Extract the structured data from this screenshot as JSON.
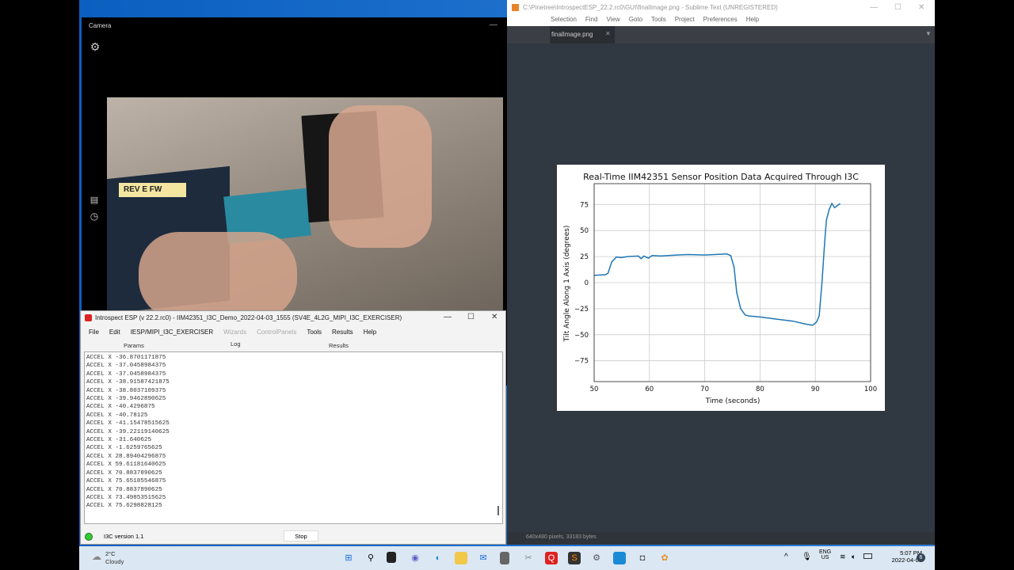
{
  "camera": {
    "title": "Camera"
  },
  "introspect": {
    "title": "Introspect ESP (v 22.2.rc0) - IIM42351_I3C_Demo_2022-04-03_1555 (SV4E_4L2G_MIPI_I3C_EXERCISER)",
    "menu": [
      "File",
      "Edit",
      "IESP/MIPI_I3C_EXERCISER",
      "Wizards",
      "ControlPanels",
      "Tools",
      "Results",
      "Help"
    ],
    "tabs": [
      "Params",
      "Log",
      "Results"
    ],
    "log": [
      "ACCEL X -36.8701171875",
      "ACCEL X -37.0458984375",
      "ACCEL X -37.0458984375",
      "ACCEL X -38.91587421875",
      "ACCEL X -38.8037109375",
      "ACCEL X -39.9462890625",
      "ACCEL X -40.4296875",
      "ACCEL X -40.78125",
      "ACCEL X -41.15478515625",
      "ACCEL X -39.22119140625",
      "ACCEL X -31.640625",
      "ACCEL X -1.6259765625",
      "ACCEL X 28.89404296875",
      "ACCEL X 59.61181640625",
      "ACCEL X 70.8837890625",
      "ACCEL X 75.65185546875",
      "ACCEL X 70.8837890625",
      "ACCEL X 73.49853515625",
      "ACCEL X 75.6298828125"
    ],
    "status": "I3C version 1.1",
    "stop": "Stop",
    "status_color": "#33cc33"
  },
  "sublime": {
    "title": "C:\\Pinetree\\IntrospectESP_22.2.rc0\\GUI\\finalImage.png - Sublime Text (UNREGISTERED)",
    "menu": [
      "Selection",
      "Find",
      "View",
      "Goto",
      "Tools",
      "Project",
      "Preferences",
      "Help"
    ],
    "tab": "finalImage.png",
    "status": "640x480 pixels, 33183 bytes"
  },
  "chart_data": {
    "type": "line",
    "title": "Real-Time IIM42351 Sensor Position Data Acquired Through I3C",
    "xlabel": "Time (seconds)",
    "ylabel": "Tilt Angle Along 1 Axis (degrees)",
    "xlim": [
      50,
      100
    ],
    "ylim": [
      -95,
      95
    ],
    "xticks": [
      50,
      60,
      70,
      80,
      90,
      100
    ],
    "yticks": [
      75,
      50,
      25,
      0,
      -25,
      -50,
      -75
    ],
    "grid": true,
    "color": "#1f77b4",
    "x": [
      50,
      52,
      52.5,
      53.2,
      54,
      55,
      56,
      58,
      58.5,
      59,
      59.8,
      60.5,
      62,
      65,
      67,
      70,
      74,
      74.7,
      75.3,
      75.8,
      76.5,
      77.3,
      78,
      80,
      83,
      86,
      88,
      89.5,
      90.2,
      90.7,
      91.2,
      91.7,
      92,
      92.5,
      93,
      93.5,
      94.5
    ],
    "y": [
      7,
      7.5,
      9,
      20,
      24.5,
      24,
      25,
      25.5,
      23,
      25.5,
      23.5,
      26,
      25.5,
      26.5,
      27,
      26.5,
      27.5,
      26,
      15,
      -10,
      -25,
      -31,
      -32,
      -33,
      -35,
      -37,
      -39.5,
      -41,
      -38,
      -32,
      0,
      40,
      60,
      70,
      76,
      72,
      76
    ]
  },
  "taskbar": {
    "weather_temp": "2°C",
    "weather_desc": "Cloudy",
    "lang1": "ENG",
    "lang2": "US",
    "time": "5:07 PM",
    "date": "2022-04-03",
    "notifications": "6"
  }
}
